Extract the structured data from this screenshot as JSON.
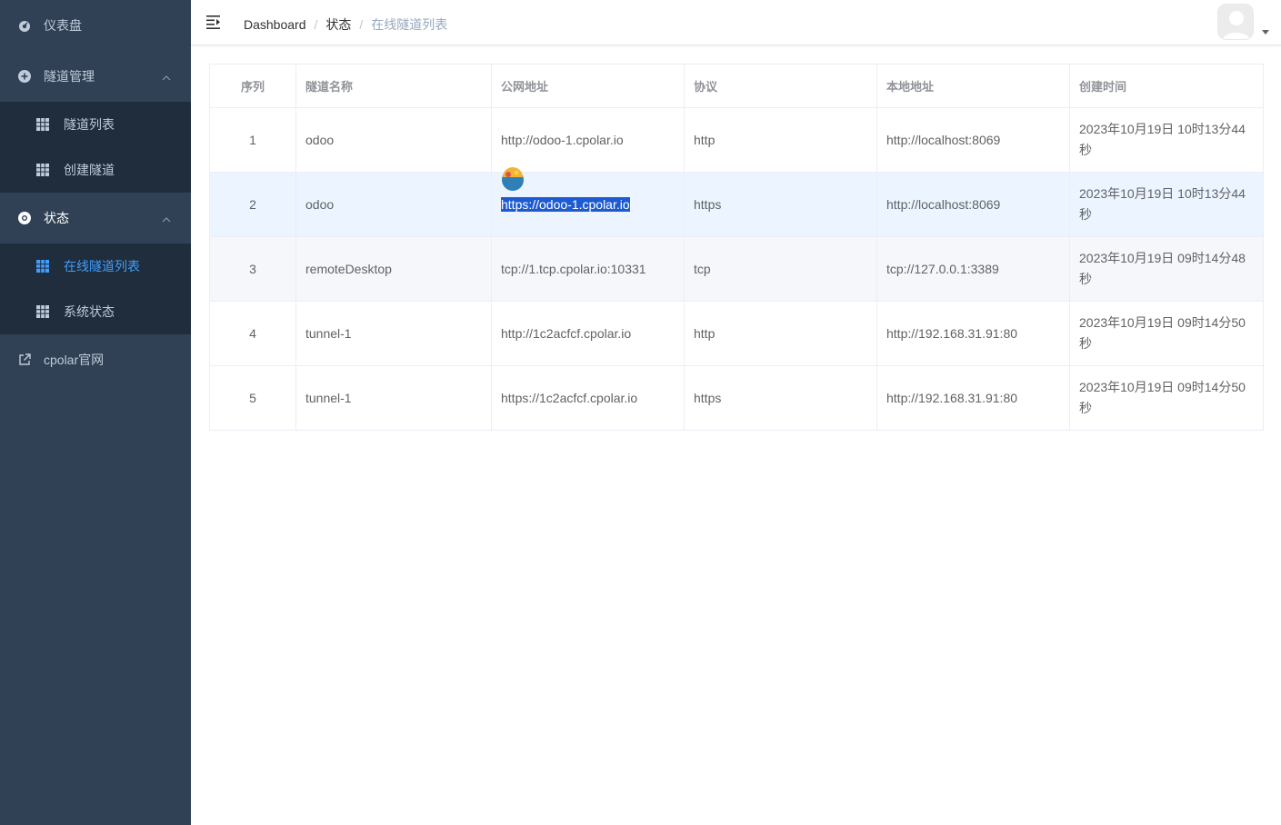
{
  "sidebar": {
    "dashboard_label": "仪表盘",
    "tunnel_mgmt_label": "隧道管理",
    "tunnel_list_label": "隧道列表",
    "create_tunnel_label": "创建隧道",
    "status_label": "状态",
    "online_tunnels_label": "在线隧道列表",
    "system_status_label": "系统状态",
    "cpolar_site_label": "cpolar官网"
  },
  "breadcrumb": {
    "home": "Dashboard",
    "sep": "/",
    "section": "状态",
    "current": "在线隧道列表"
  },
  "table": {
    "headers": [
      "序列",
      "隧道名称",
      "公网地址",
      "协议",
      "本地地址",
      "创建时间"
    ],
    "rows": [
      {
        "idx": "1",
        "name": "odoo",
        "public": "http://odoo-1.cpolar.io",
        "proto": "http",
        "local": "http://localhost:8069",
        "created": "2023年10月19日 10时13分44秒"
      },
      {
        "idx": "2",
        "name": "odoo",
        "public": "https://odoo-1.cpolar.io",
        "proto": "https",
        "local": "http://localhost:8069",
        "created": "2023年10月19日 10时13分44秒"
      },
      {
        "idx": "3",
        "name": "remoteDesktop",
        "public": "tcp://1.tcp.cpolar.io:10331",
        "proto": "tcp",
        "local": "tcp://127.0.0.1:3389",
        "created": "2023年10月19日 09时14分48秒"
      },
      {
        "idx": "4",
        "name": "tunnel-1",
        "public": "http://1c2acfcf.cpolar.io",
        "proto": "http",
        "local": "http://192.168.31.91:80",
        "created": "2023年10月19日 09时14分50秒"
      },
      {
        "idx": "5",
        "name": "tunnel-1",
        "public": "https://1c2acfcf.cpolar.io",
        "proto": "https",
        "local": "http://192.168.31.91:80",
        "created": "2023年10月19日 09时14分50秒"
      }
    ]
  },
  "colors": {
    "sidebar_bg": "#304156",
    "submenu_bg": "#1f2d3d",
    "active": "#409eff",
    "selection": "#1e5bd0"
  }
}
